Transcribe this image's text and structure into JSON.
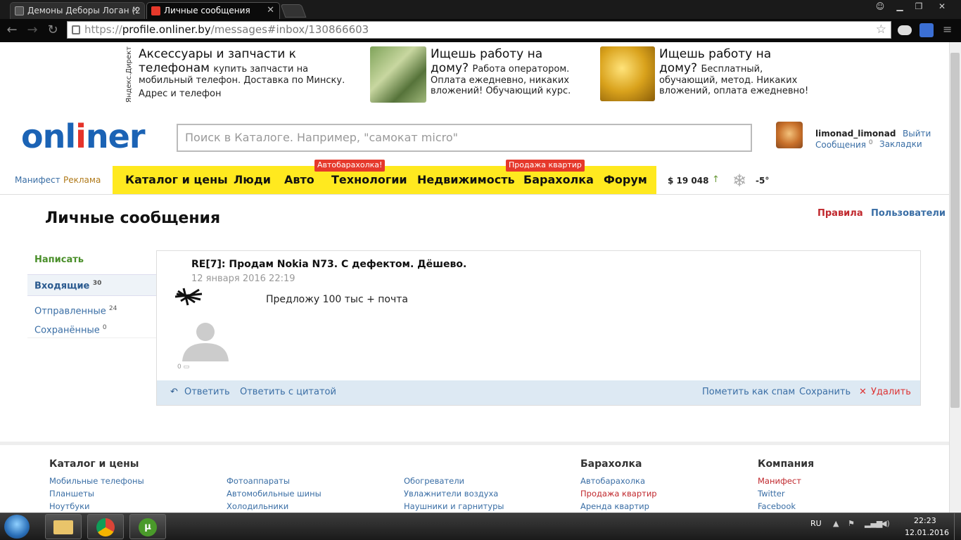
{
  "browser": {
    "tabs": [
      {
        "title": "Демоны Деборы Логан (2"
      },
      {
        "title": "Личные сообщения"
      }
    ],
    "url_scheme": "https://",
    "url_host": "profile.onliner.by",
    "url_path": "/messages#inbox/130866603"
  },
  "ads": [
    {
      "title_a": "Аксессуары и запчасти к",
      "title_b": "телефонам",
      "text_inline": "купить запчасти на",
      "text": "мобильный телефон. Доставка по Минску.",
      "extra": "Адрес и телефон"
    },
    {
      "title_a": "Ищешь работу на",
      "title_b": "дому?",
      "text_inline": "Работа оператором.",
      "text": "Оплата ежедневно, никаких",
      "text2": "вложений! Обучающий курс."
    },
    {
      "title_a": "Ищешь работу на",
      "title_b": "дому?",
      "text_inline": "Бесплатный,",
      "text": "обучающий, метод. Никаких",
      "text2": "вложений, оплата ежедневно!"
    }
  ],
  "yandex_direct": "Яндекс.Директ",
  "header": {
    "logo_a": "onl",
    "logo_i": "i",
    "logo_b": "ner",
    "search_placeholder": "Поиск в Каталоге. Например, \"самокат micro\"",
    "username": "limonad_limonad",
    "logout": "Выйти",
    "messages": "Сообщения",
    "messages_count": "0",
    "bookmarks": "Закладки"
  },
  "nav": {
    "manifest": "Манифест",
    "ads_link": "Реклама",
    "menu": [
      "Каталог и цены",
      "Люди",
      "Авто",
      "Технологии",
      "Недвижимость",
      "Барахолка",
      "Форум"
    ],
    "badge_auto": "Автобарахолка!",
    "badge_flats": "Продажа квартир",
    "currency": "$ 19 048",
    "currency_arrow": "↑",
    "temperature": "-5°"
  },
  "page": {
    "title": "Личные сообщения",
    "rules": "Правила",
    "users": "Пользователи"
  },
  "sidebar": {
    "write": "Написать",
    "inbox": "Входящие",
    "inbox_count": "30",
    "sent": "Отправленные",
    "sent_count": "24",
    "saved": "Сохранённые",
    "saved_count": "0"
  },
  "message": {
    "subject": "RE[7]: Продам Nokia N73. С дефектом. Дёшево.",
    "date": "12 января 2016  22:19",
    "body": "Предложу 100 тыс + почта",
    "comments_count": "0"
  },
  "actions": {
    "reply": "Ответить",
    "reply_quote": "Ответить с цитатой",
    "spam": "Пометить как спам",
    "save": "Сохранить",
    "delete": "Удалить"
  },
  "footer": {
    "columns": [
      {
        "heading": "Каталог и цены",
        "links": [
          "Мобильные телефоны",
          "Планшеты",
          "Ноутбуки"
        ]
      },
      {
        "heading": "",
        "links": [
          "Фотоаппараты",
          "Автомобильные шины",
          "Холодильники"
        ]
      },
      {
        "heading": "",
        "links": [
          "Обогреватели",
          "Увлажнители воздуха",
          "Наушники и гарнитуры"
        ]
      },
      {
        "heading": "Барахолка",
        "links": [
          "Автобарахолка",
          "Продажа квартир",
          "Аренда квартир"
        ]
      },
      {
        "heading": "Компания",
        "links": [
          "Манифест",
          "Twitter",
          "Facebook"
        ]
      }
    ]
  },
  "taskbar": {
    "lang": "RU",
    "time": "22:23",
    "date": "12.01.2016"
  },
  "colors": {
    "nav_yellow": "#ffe91f",
    "badge_red": "#e6392b",
    "link_blue": "#3a6ea5",
    "write_green": "#4a8f2a",
    "rules_red": "#c0282d",
    "logo_blue": "#1b63b5"
  }
}
